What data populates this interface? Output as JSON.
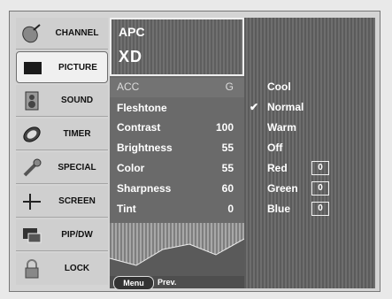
{
  "sidebar": {
    "items": [
      {
        "label": "CHANNEL",
        "icon": "satellite-dish-icon",
        "active": false
      },
      {
        "label": "PICTURE",
        "icon": "tv-screen-icon",
        "active": true
      },
      {
        "label": "SOUND",
        "icon": "speaker-icon",
        "active": false
      },
      {
        "label": "TIMER",
        "icon": "clock-icon",
        "active": false
      },
      {
        "label": "SPECIAL",
        "icon": "wrench-icon",
        "active": false
      },
      {
        "label": "SCREEN",
        "icon": "crosshair-icon",
        "active": false
      },
      {
        "label": "PIP/DW",
        "icon": "pip-window-icon",
        "active": false
      },
      {
        "label": "LOCK",
        "icon": "padlock-icon",
        "active": false
      }
    ]
  },
  "picture_menu": {
    "apc_title": "APC",
    "apc_logo": "XD",
    "rows": [
      {
        "label": "ACC",
        "value": "G"
      },
      {
        "label": "Fleshtone",
        "value": ""
      },
      {
        "label": "Contrast",
        "value": "100"
      },
      {
        "label": "Brightness",
        "value": "55"
      },
      {
        "label": "Color",
        "value": "55"
      },
      {
        "label": "Sharpness",
        "value": "60"
      },
      {
        "label": "Tint",
        "value": "0"
      }
    ],
    "footer": {
      "menu_label": "Menu",
      "prev_label": "Prev."
    }
  },
  "acc_submenu": {
    "options": [
      {
        "label": "Cool",
        "checked": false
      },
      {
        "label": "Normal",
        "checked": true
      },
      {
        "label": "Warm",
        "checked": false
      },
      {
        "label": "Off",
        "checked": false
      }
    ],
    "channels": [
      {
        "label": "Red",
        "value": "0"
      },
      {
        "label": "Green",
        "value": "0"
      },
      {
        "label": "Blue",
        "value": "0"
      }
    ],
    "check_glyph": "✔"
  },
  "colors": {
    "panel_bg": "#6a6a6a",
    "active_bg": "#f0f0f0",
    "text_on_dark": "#ffffff"
  }
}
